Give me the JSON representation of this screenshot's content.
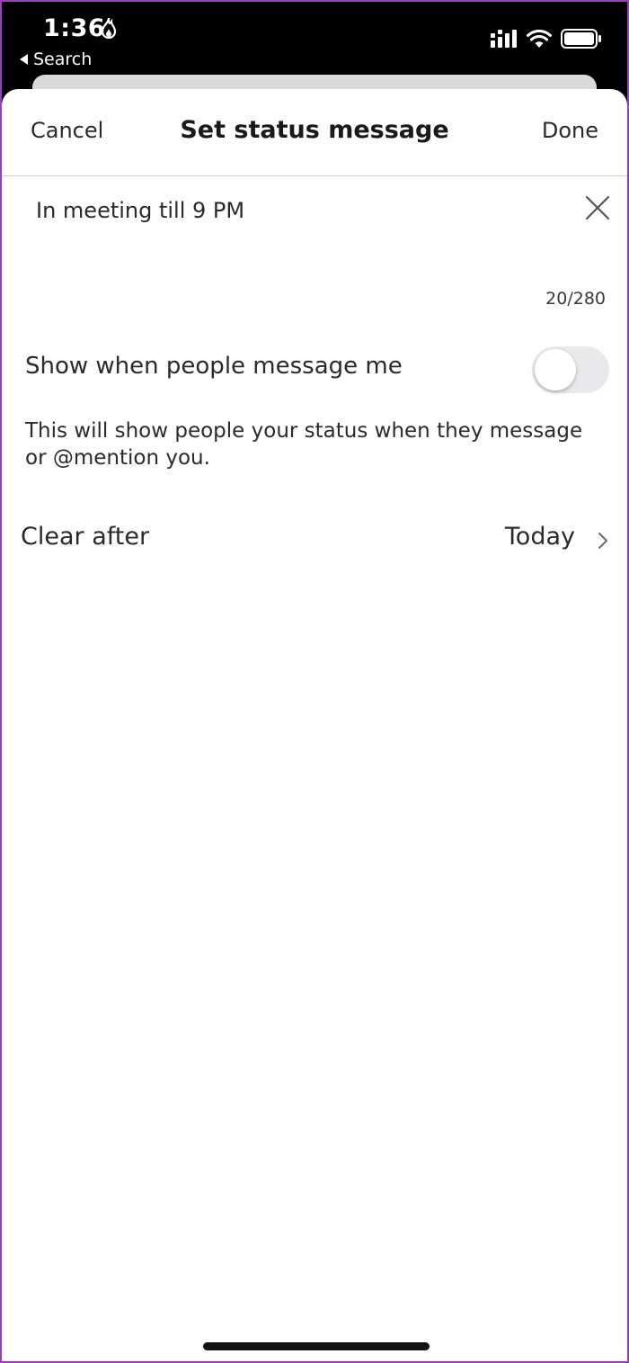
{
  "status_bar": {
    "time": "1:36",
    "back_label": "Search"
  },
  "nav": {
    "cancel_label": "Cancel",
    "title": "Set status message",
    "done_label": "Done"
  },
  "message": {
    "value": "In meeting till 9 PM",
    "counter": "20/280"
  },
  "show_when_messaged": {
    "label": "Show when people message me",
    "enabled": false,
    "description": "This will show people your status when they message or @mention you."
  },
  "clear_after": {
    "label": "Clear after",
    "value": "Today"
  },
  "colors": {
    "toggle_off": "#e9e9eb",
    "status_bar_bg": "#000000",
    "sheet_bg": "#ffffff"
  }
}
